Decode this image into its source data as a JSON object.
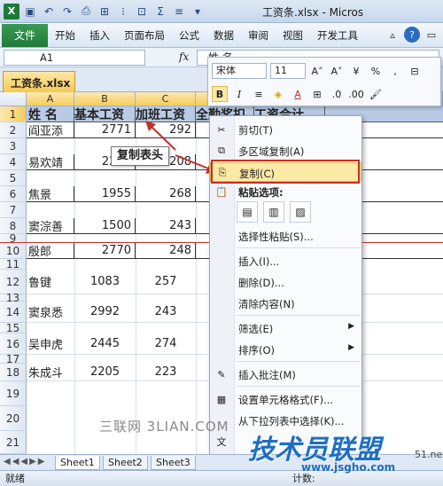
{
  "window": {
    "title": "工资条.xlsx - Micros"
  },
  "ribbon": {
    "file": "文件",
    "tabs": [
      "开始",
      "插入",
      "页面布局",
      "公式",
      "数据",
      "审阅",
      "视图",
      "开发工具"
    ]
  },
  "formula": {
    "namebox": "A1",
    "fx": "fx",
    "value": "姓  名"
  },
  "workbook": {
    "tab": "工资条.xlsx"
  },
  "columns": [
    "A",
    "B",
    "C",
    "D"
  ],
  "rows": [
    "1",
    "2",
    "3",
    "4",
    "5",
    "6",
    "7",
    "8",
    "9",
    "10",
    "11",
    "12",
    "13",
    "14",
    "15",
    "16",
    "17",
    "18",
    "19",
    "20",
    "21"
  ],
  "header": [
    "姓 名",
    "基本工资",
    "加班工资",
    "全勤奖扣",
    "工资合计"
  ],
  "data": [
    [
      "阎亚添",
      "2771",
      "292"
    ],
    [
      "易欢靖",
      "2279",
      "208"
    ],
    [
      "焦景",
      "1955",
      "268"
    ],
    [
      "窦淙善",
      "1500",
      "243"
    ],
    [
      "殷郎",
      "2770",
      "248"
    ],
    [
      "鲁键",
      "1083",
      "257"
    ],
    [
      "窦泉悉",
      "2992",
      "243"
    ],
    [
      "吴申虎",
      "2445",
      "274"
    ],
    [
      "朱成斗",
      "2205",
      "223"
    ]
  ],
  "callout": "复制表头",
  "mini": {
    "font": "宋体",
    "size": "11",
    "bold": "B",
    "italic": "I",
    "percent": "%",
    "comma": ","
  },
  "menu": {
    "cut": "剪切(T)",
    "multicopy": "多区域复制(A)",
    "copy": "复制(C)",
    "paste_opts": "粘贴选项:",
    "paste_special": "选择性粘贴(S)...",
    "insert": "插入(I)...",
    "delete": "删除(D)...",
    "clear": "清除内容(N)",
    "filter": "筛选(E)",
    "sort": "排序(O)",
    "comment": "插入批注(M)",
    "format": "设置单元格格式(F)...",
    "pick": "从下拉列表中选择(K)..."
  },
  "sheets": [
    "Sheet1",
    "Sheet2",
    "Sheet3"
  ],
  "status": {
    "ready": "就绪",
    "count": "计数:"
  },
  "watermark": "三联网 3LIAN.COM",
  "brand": {
    "logo": "技术员联盟",
    "url": "www.jsgho.com",
    "corner": "51.net"
  }
}
